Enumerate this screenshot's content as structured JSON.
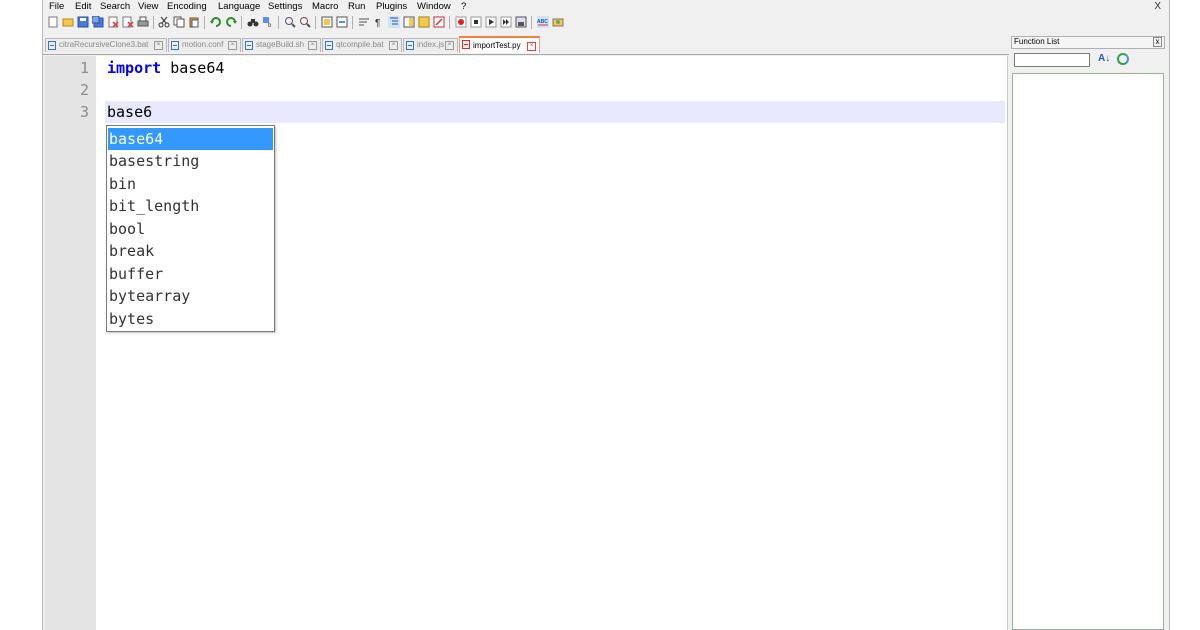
{
  "menubar": {
    "items": [
      "File",
      "Edit",
      "Search",
      "View",
      "Encoding",
      "Language",
      "Settings",
      "Macro",
      "Run",
      "Plugins",
      "Window",
      "?"
    ],
    "close": "X"
  },
  "toolbar": {
    "icons": [
      "new-file-icon",
      "open-file-icon",
      "save-icon",
      "save-all-icon",
      "close-icon",
      "close-all-icon",
      "print-icon",
      "cut-icon",
      "copy-icon",
      "paste-icon",
      "undo-icon",
      "redo-icon",
      "find-icon",
      "replace-icon",
      "zoom-in-icon",
      "zoom-out-icon",
      "sync-vertical-icon",
      "sync-horizontal-icon",
      "word-wrap-icon",
      "show-all-chars-icon",
      "indent-guide-icon",
      "document-map-icon",
      "function-list-icon",
      "folder-as-workspace-icon",
      "record-macro-icon",
      "stop-macro-icon",
      "play-macro-icon",
      "run-macro-multiple-icon",
      "save-macro-icon",
      "spell-check-icon",
      "plugin-icon"
    ]
  },
  "tabs": [
    {
      "label": "citraRecursiveClone3.bat",
      "active": false
    },
    {
      "label": "motion.conf",
      "active": false
    },
    {
      "label": "stageBuild.sh",
      "active": false
    },
    {
      "label": "qtcompile.bat",
      "active": false
    },
    {
      "label": "index.js",
      "active": false
    },
    {
      "label": "importTest.py",
      "active": true
    }
  ],
  "editor": {
    "line_numbers": [
      "1",
      "2",
      "3"
    ],
    "line1_keyword": "import",
    "line1_rest": " base64",
    "line3": "base6"
  },
  "autocomplete": {
    "items": [
      "base64",
      "basestring",
      "bin",
      "bit_length",
      "bool",
      "break",
      "buffer",
      "bytearray",
      "bytes"
    ],
    "selected_index": 0
  },
  "function_list": {
    "title": "Function List",
    "close": "x",
    "sort_label": "A↓",
    "search_value": ""
  },
  "colors": {
    "keyword": "#0000ff",
    "selection": "#3399ff",
    "current_line": "#e8e8ff",
    "active_tab_accent": "#f08040"
  }
}
